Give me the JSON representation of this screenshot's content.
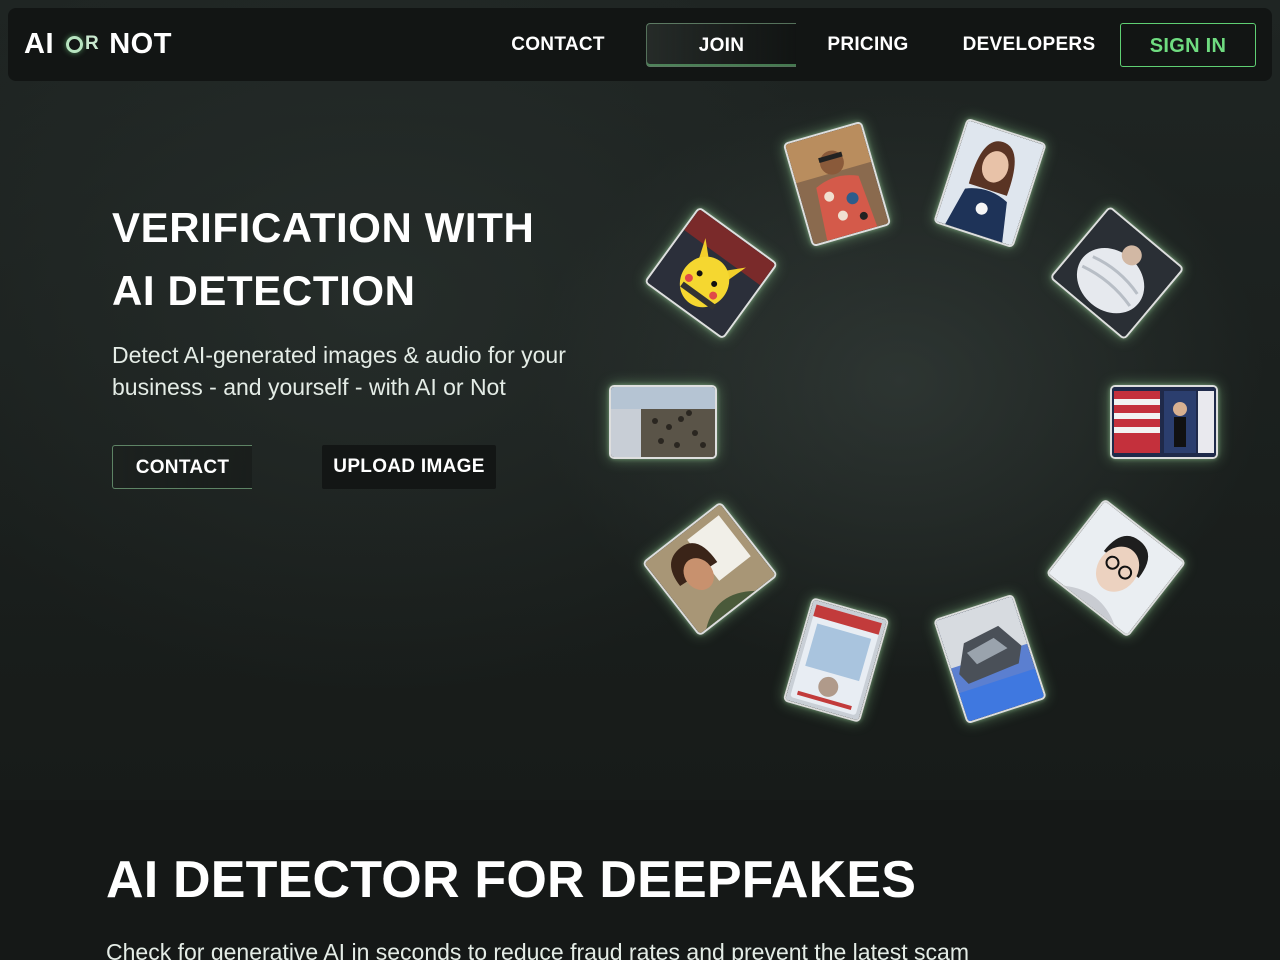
{
  "brand": {
    "logo_left": "AI",
    "logo_mid": "R",
    "logo_right": "NOT"
  },
  "nav": {
    "contact": "CONTACT",
    "join": "JOIN",
    "pricing": "PRICING",
    "developers": "DEVELOPERS",
    "sign_in": "SIGN IN"
  },
  "hero": {
    "title_line1": "VERIFICATION WITH",
    "title_line2": "AI DETECTION",
    "subtitle_line1": "Detect AI-generated images & audio for your",
    "subtitle_line2": "business - and yourself - with AI or Not",
    "contact_button": "CONTACT",
    "upload_button": "UPLOAD IMAGE"
  },
  "gallery": {
    "images": [
      {
        "name": "man-floral-shirt-photo"
      },
      {
        "name": "woman-portrait-photo"
      },
      {
        "name": "puffer-jacket-photo"
      },
      {
        "name": "political-poster-photo"
      },
      {
        "name": "man-glasses-photo"
      },
      {
        "name": "car-crash-photo"
      },
      {
        "name": "id-card-photo"
      },
      {
        "name": "woman-document-photo"
      },
      {
        "name": "crowd-aerial-photo"
      },
      {
        "name": "pikachu-photo"
      }
    ]
  },
  "section2": {
    "title": "AI DETECTOR FOR DEEPFAKES",
    "text": "Check for generative AI in seconds to reduce fraud rates and prevent the latest scam"
  },
  "colors": {
    "accent_green": "#6fdc80",
    "background": "#1a1f1d",
    "nav_background": "#121514"
  }
}
